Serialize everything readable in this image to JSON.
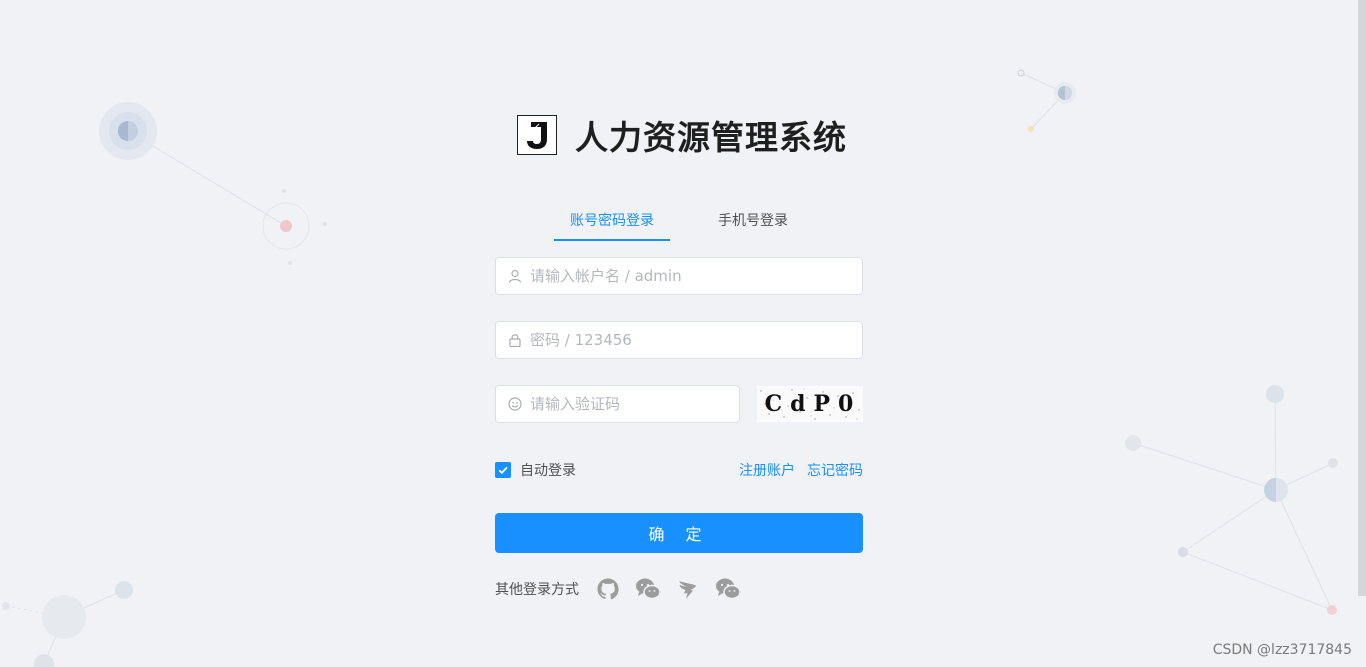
{
  "app": {
    "title": "人力资源管理系统"
  },
  "tabs": [
    {
      "label": "账号密码登录",
      "active": true
    },
    {
      "label": "手机号登录",
      "active": false
    }
  ],
  "form": {
    "username_placeholder": "请输入帐户名 / admin",
    "password_placeholder": "密码 / 123456",
    "captcha_placeholder": "请输入验证码",
    "captcha_text": "CdP0",
    "remember_label": "自动登录",
    "remember_checked": true,
    "register_link": "注册账户",
    "forgot_link": "忘记密码",
    "submit_label": "确 定"
  },
  "other_login": {
    "label": "其他登录方式",
    "icons": [
      "github-icon",
      "wechat-icon",
      "dingtalk-icon",
      "wechat-icon"
    ]
  },
  "watermark": "CSDN @lzz3717845",
  "colors": {
    "primary": "#1890ff",
    "background": "#f0f2f5"
  }
}
